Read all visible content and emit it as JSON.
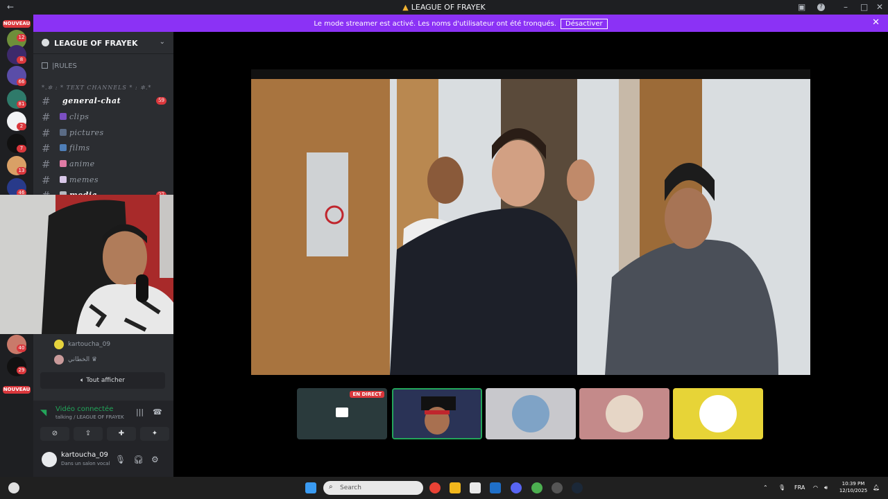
{
  "window": {
    "title": "LEAGUE OF FRAYEK",
    "back_icon": "arrow-left-icon"
  },
  "banner": {
    "text": "Le mode streamer est activé. Les noms d'utilisateur ont été tronqués.",
    "button_label": "Désactiver",
    "close_icon": "close-icon"
  },
  "server_rail": {
    "top_label": "NOUVEAU",
    "bottom_label": "NOUVEAU",
    "badges": [
      "12",
      "8",
      "66",
      "81",
      "2",
      "7",
      "13",
      "46",
      "40",
      "29"
    ]
  },
  "guild": {
    "name": "LEAGUE OF FRAYEK",
    "rules_label": "|RULES",
    "category": "*.✲ : * TEXT CHANNELS * : ✲.*",
    "channels": [
      {
        "label": "general-chat",
        "count": "59",
        "active": true
      },
      {
        "label": "clips"
      },
      {
        "label": "pictures"
      },
      {
        "label": "films"
      },
      {
        "label": "anime"
      },
      {
        "label": "memes"
      },
      {
        "label": "media",
        "count": "27"
      }
    ]
  },
  "voice_users": [
    {
      "name": "kartoucha_09"
    },
    {
      "name": "الخطاني ♛"
    }
  ],
  "show_all_label": "Tout afficher",
  "voice_panel": {
    "title": "Vidéo connectée",
    "subtitle": "talking / LEAGUE OF FRAYEK"
  },
  "user": {
    "name": "kartoucha_09",
    "status": "Dans un salon vocal"
  },
  "stage": {
    "live_label": "EN DIRECT"
  },
  "taskbar": {
    "search_placeholder": "Search",
    "lang": "FRA",
    "time": "10:39 PM",
    "date": "12/10/2025"
  },
  "colors": {
    "banner": "#8b32f5",
    "accent_green": "#23a55a",
    "badge_red": "#da373c"
  }
}
